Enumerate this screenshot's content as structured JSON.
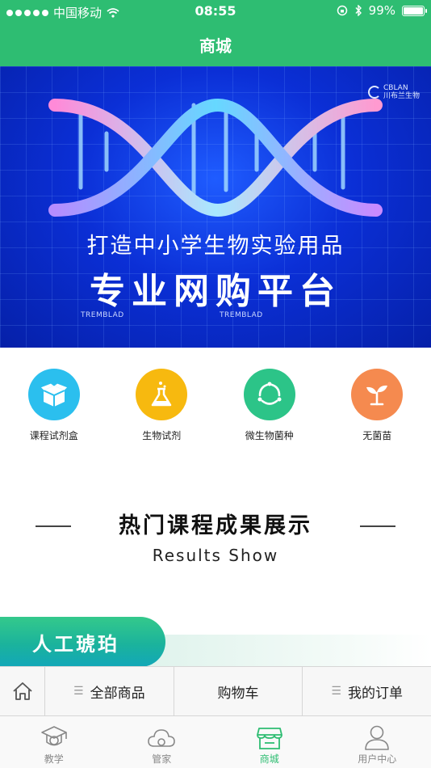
{
  "status_bar": {
    "carrier": "中国移动",
    "time": "08:55",
    "battery": "99%",
    "battery_level": 0.99,
    "icons": [
      "signal-dots-icon",
      "wifi-icon",
      "orientation-lock-icon",
      "bluetooth-icon",
      "battery-icon"
    ]
  },
  "nav": {
    "title": "商城"
  },
  "banner": {
    "brand_line1": "CBLAN",
    "brand_line2": "川布兰生物",
    "line1": "打造中小学生物实验用品",
    "line2": "专业网购平台",
    "watermark": "TREMBLAD"
  },
  "categories": [
    {
      "label": "课程试剂盒",
      "icon": "box-icon",
      "color": "#2bbfee"
    },
    {
      "label": "生物试剂",
      "icon": "flask-icon",
      "color": "#f7b90f"
    },
    {
      "label": "微生物菌种",
      "icon": "cycle-icon",
      "color": "#2cc488"
    },
    {
      "label": "无菌苗",
      "icon": "sprout-icon",
      "color": "#f58a4f"
    }
  ],
  "section": {
    "title": "热门课程成果展示",
    "subtitle": "Results Show"
  },
  "course_card": {
    "label": "人工琥珀"
  },
  "shop_bar": {
    "all_products": "全部商品",
    "cart": "购物车",
    "my_orders": "我的订单"
  },
  "tab_bar": {
    "items": [
      {
        "label": "教学",
        "icon": "graduation-cap-icon",
        "active": false
      },
      {
        "label": "管家",
        "icon": "cloud-icon",
        "active": false
      },
      {
        "label": "商城",
        "icon": "store-icon",
        "active": true
      },
      {
        "label": "用户中心",
        "icon": "user-icon",
        "active": false
      }
    ],
    "active_color": "#2ebd72"
  },
  "colors": {
    "brand_green": "#2ebd72",
    "banner_blue": "#0b2fd6"
  }
}
